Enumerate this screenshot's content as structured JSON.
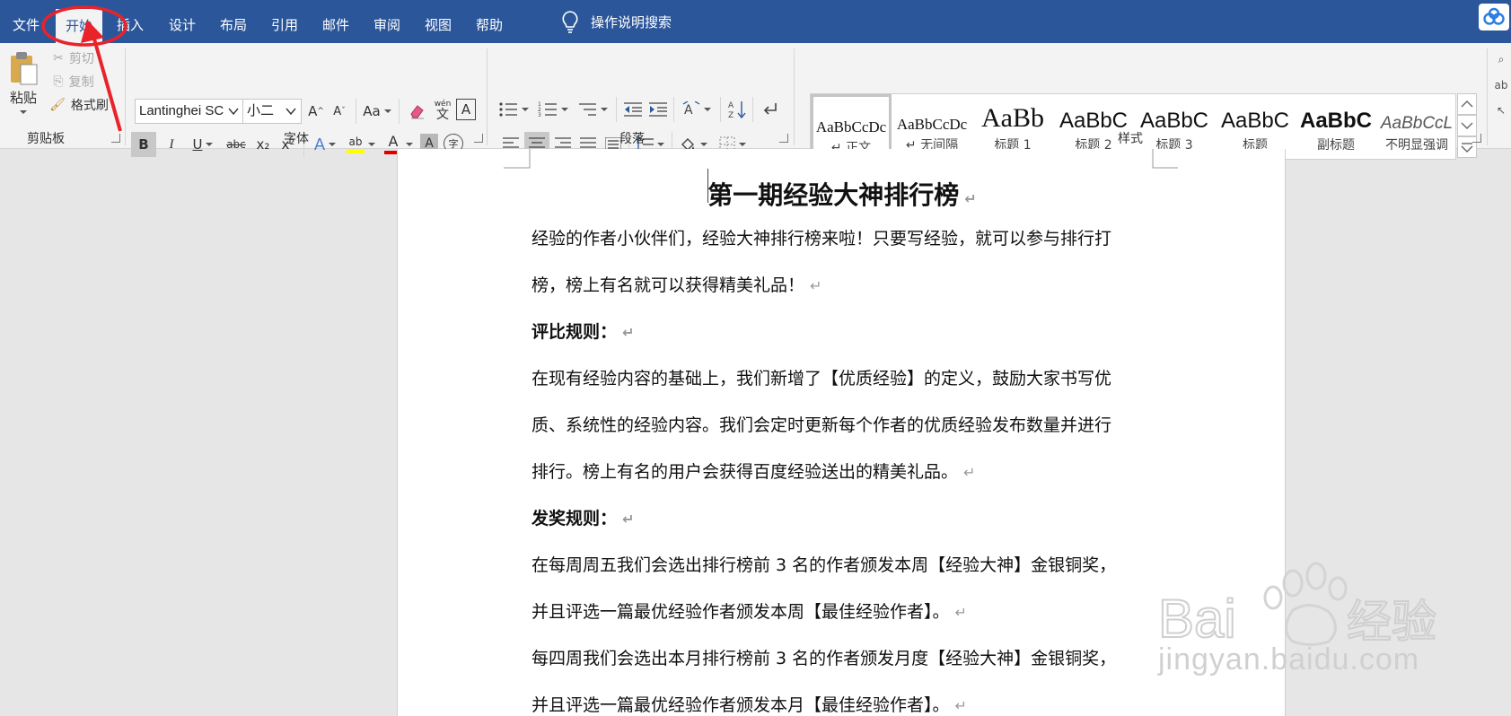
{
  "tabs": [
    {
      "label": "文件",
      "name": "tab-file"
    },
    {
      "label": "开始",
      "name": "tab-home",
      "active": true
    },
    {
      "label": "插入",
      "name": "tab-insert"
    },
    {
      "label": "设计",
      "name": "tab-design"
    },
    {
      "label": "布局",
      "name": "tab-layout"
    },
    {
      "label": "引用",
      "name": "tab-references"
    },
    {
      "label": "邮件",
      "name": "tab-mailings"
    },
    {
      "label": "审阅",
      "name": "tab-review"
    },
    {
      "label": "视图",
      "name": "tab-view"
    },
    {
      "label": "帮助",
      "name": "tab-help"
    }
  ],
  "tell_me": {
    "label": "操作说明搜索",
    "icon": "lightbulb-icon"
  },
  "clipboard": {
    "paste": "粘贴",
    "cut": "剪切",
    "copy": "复制",
    "format_painter": "格式刷",
    "group_label": "剪贴板"
  },
  "font": {
    "font_name": "Lantinghei SC",
    "font_size": "小二",
    "change_case": "Aa",
    "phonetic_top": "wén",
    "phonetic_bottom": "文",
    "char_border": "A",
    "grow": "A",
    "shrink": "A",
    "bold": "B",
    "italic": "I",
    "underline": "U",
    "strike": "abc",
    "subscript": "x₂",
    "superscript": "x²",
    "text_effects": "A",
    "highlight": "ab",
    "font_color": "A",
    "char_shading": "A",
    "enclose": "字",
    "group_label": "字体",
    "highlight_color": "#ffff00",
    "font_color_value": "#e00000"
  },
  "paragraph": {
    "group_label": "段落"
  },
  "styles": {
    "items": [
      {
        "preview": "AaBbCcDc",
        "name": "↵ 正文",
        "selected": true
      },
      {
        "preview": "AaBbCcDc",
        "name": "↵ 无间隔"
      },
      {
        "preview": "AaBb",
        "name": "标题 1"
      },
      {
        "preview": "AaBbC",
        "name": "标题 2"
      },
      {
        "preview": "AaBbC",
        "name": "标题 3"
      },
      {
        "preview": "AaBbC",
        "name": "标题"
      },
      {
        "preview": "AaBbC",
        "name": "副标题"
      },
      {
        "preview": "AaBbCcL",
        "name": "不明显强调"
      }
    ],
    "group_label": "样式"
  },
  "document": {
    "title": "第一期经验大神排行榜",
    "paragraph_mark": "↵",
    "lines": [
      {
        "text": "经验的作者小伙伴们，经验大神排行榜来啦！只要写经验，就可以参与排行打",
        "bold": false,
        "mark": false
      },
      {
        "text": "榜，榜上有名就可以获得精美礼品！",
        "bold": false,
        "mark": true
      },
      {
        "text": "评比规则：",
        "bold": true,
        "mark": true
      },
      {
        "text": "在现有经验内容的基础上，我们新增了【优质经验】的定义，鼓励大家书写优",
        "bold": false,
        "mark": false
      },
      {
        "text": "质、系统性的经验内容。我们会定时更新每个作者的优质经验发布数量并进行",
        "bold": false,
        "mark": false
      },
      {
        "text": "排行。榜上有名的用户会获得百度经验送出的精美礼品。",
        "bold": false,
        "mark": true
      },
      {
        "text": "发奖规则：",
        "bold": true,
        "mark": true
      },
      {
        "text": "在每周周五我们会选出排行榜前 3 名的作者颁发本周【经验大神】金银铜奖，",
        "bold": false,
        "mark": false
      },
      {
        "text": "并且评选一篇最优经验作者颁发本周【最佳经验作者】。",
        "bold": false,
        "mark": true
      },
      {
        "text": "每四周我们会选出本月排行榜前 3 名的作者颁发月度【经验大神】金银铜奖，",
        "bold": false,
        "mark": false
      },
      {
        "text": "并且评选一篇最优经验作者颁发本月【最佳经验作者】。",
        "bold": false,
        "mark": true
      }
    ]
  },
  "watermark": {
    "brand": "Bai",
    "suffix": "经验",
    "url": "jingyan.baidu.com"
  },
  "colors": {
    "ribbon_blue": "#2b579a",
    "annotation_red": "#e8232a"
  }
}
